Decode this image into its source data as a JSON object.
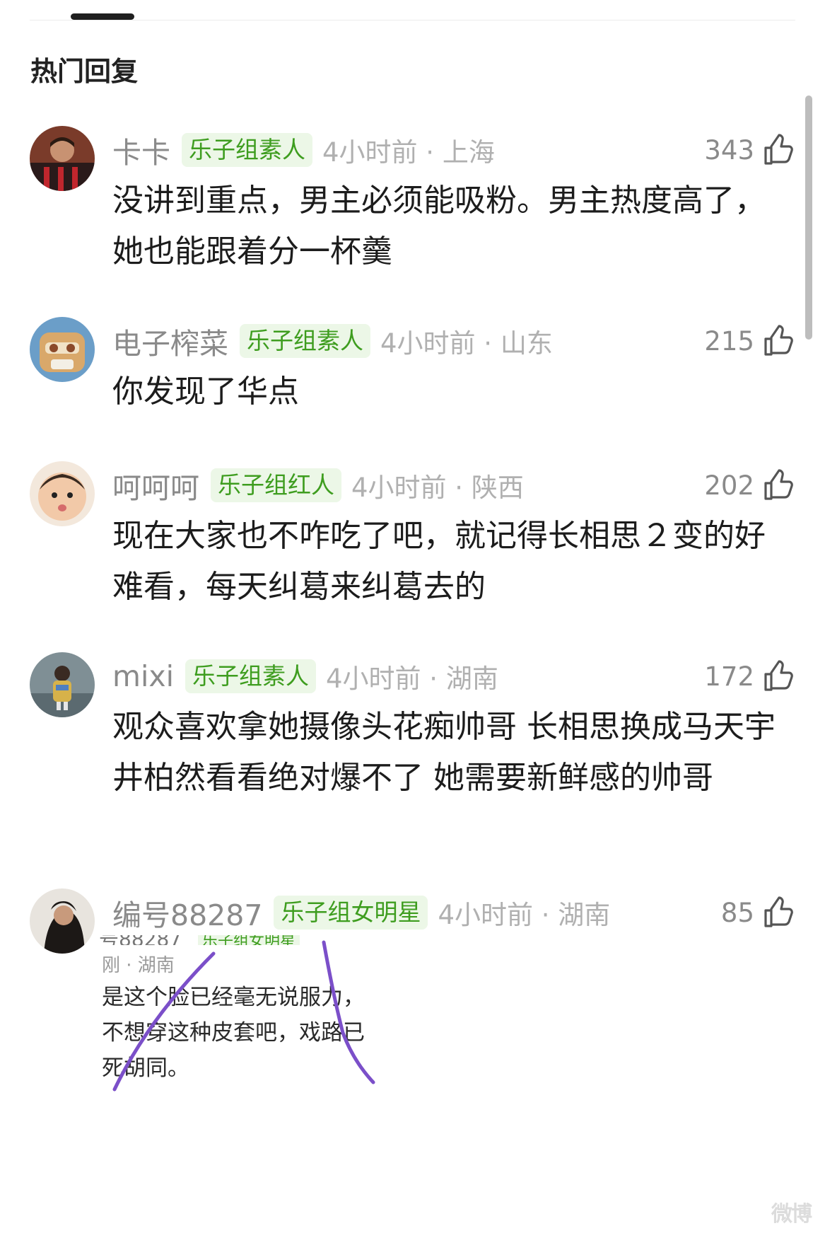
{
  "section_title": "热门回复",
  "badge_color": "#3e9d1f",
  "comments": [
    {
      "username": "卡卡",
      "badge": "乐子组素人",
      "time_location": "4小时前 · 上海",
      "likes": "343",
      "text": "没讲到重点，男主必须能吸粉。男主热度高了，她也能跟着分一杯羹"
    },
    {
      "username": "电子榨菜",
      "badge": "乐子组素人",
      "time_location": "4小时前 · 山东",
      "likes": "215",
      "text": "你发现了华点"
    },
    {
      "username": "呵呵呵",
      "badge": "乐子组红人",
      "time_location": "4小时前 · 陕西",
      "likes": "202",
      "text": "现在大家也不咋吃了吧，就记得长相思２变的好难看，每天纠葛来纠葛去的"
    },
    {
      "username": "mixi",
      "badge": "乐子组素人",
      "time_location": "4小时前 · 湖南",
      "likes": "172",
      "text": "观众喜欢拿她摄像头花痴帅哥 长相思换成马天宇井柏然看看绝对爆不了 她需要新鲜感的帅哥"
    },
    {
      "username": "编号88287",
      "badge": "乐子组女明星",
      "time_location": "4小时前 · 湖南",
      "likes": "85",
      "text": ""
    }
  ],
  "embedded_fragment": {
    "top_username": "号88287",
    "top_badge": "乐子组女明星",
    "location": "刚 · 湖南",
    "lines": [
      "是这个脸已经毫无说服力，",
      "不想穿这种皮套吧，戏路已",
      "死胡同。"
    ]
  },
  "watermark": "微博"
}
